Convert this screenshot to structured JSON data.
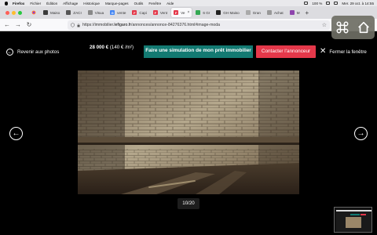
{
  "menubar": {
    "app": "Firefox",
    "items": [
      "Fichier",
      "Édition",
      "Affichage",
      "Historique",
      "Marque-pages",
      "Outils",
      "Fenêtre",
      "Aide"
    ],
    "battery": "100 %",
    "clock": "Mer. 29 oct. à 14:55"
  },
  "tabs": [
    {
      "label": "Maiso",
      "favicon_color": "#3a3a3a",
      "favicon_text": ""
    },
    {
      "label": "ZACI",
      "favicon_color": "#555",
      "favicon_text": ""
    },
    {
      "label": "Visua",
      "favicon_color": "#888",
      "favicon_text": ""
    },
    {
      "label": "vente",
      "favicon_color": "#4285f4",
      "favicon_text": "G"
    },
    {
      "label": "Capi",
      "favicon_color": "#e4384a",
      "favicon_text": "F"
    },
    {
      "label": "Vent",
      "favicon_color": "#e4384a",
      "favicon_text": "F"
    },
    {
      "label": "Ve",
      "favicon_color": "#e4384a",
      "favicon_text": "F",
      "active": true
    },
    {
      "label": "6 Gr",
      "favicon_color": "#34a853",
      "favicon_text": ""
    },
    {
      "label": "GH Maiso",
      "favicon_color": "#222",
      "favicon_text": ""
    },
    {
      "label": "Gran",
      "favicon_color": "#aaa",
      "favicon_text": ""
    },
    {
      "label": "Achat",
      "favicon_color": "#999",
      "favicon_text": ""
    },
    {
      "label": "M",
      "favicon_color": "#8e44ad",
      "favicon_text": ""
    }
  ],
  "navbar": {
    "url_prefix": "https://immobilier.",
    "url_domain": "lefigaro.fr",
    "url_rest": "/annonces/annonce-84276376.html#image-moda"
  },
  "viewer": {
    "back_label": "Revenir aux photos",
    "price": "28 000 €",
    "surface": "(140 € /m²)",
    "simulate_label": "Faire une simulation de mon prêt immobilier",
    "contact_label": "Contacter l'annonceur",
    "close_label": "Fermer la fenêtre",
    "counter": "10/20"
  },
  "colors": {
    "simulate_button": "#137a72",
    "contact_button": "#e4384a",
    "background": "#000000"
  },
  "icons": {
    "back": "circle-arrow-left-icon",
    "prev": "circle-arrow-left-icon",
    "next": "circle-arrow-right-icon",
    "close": "close-icon",
    "overlay_left": "command-key-icon",
    "overlay_right": "home-icon"
  }
}
